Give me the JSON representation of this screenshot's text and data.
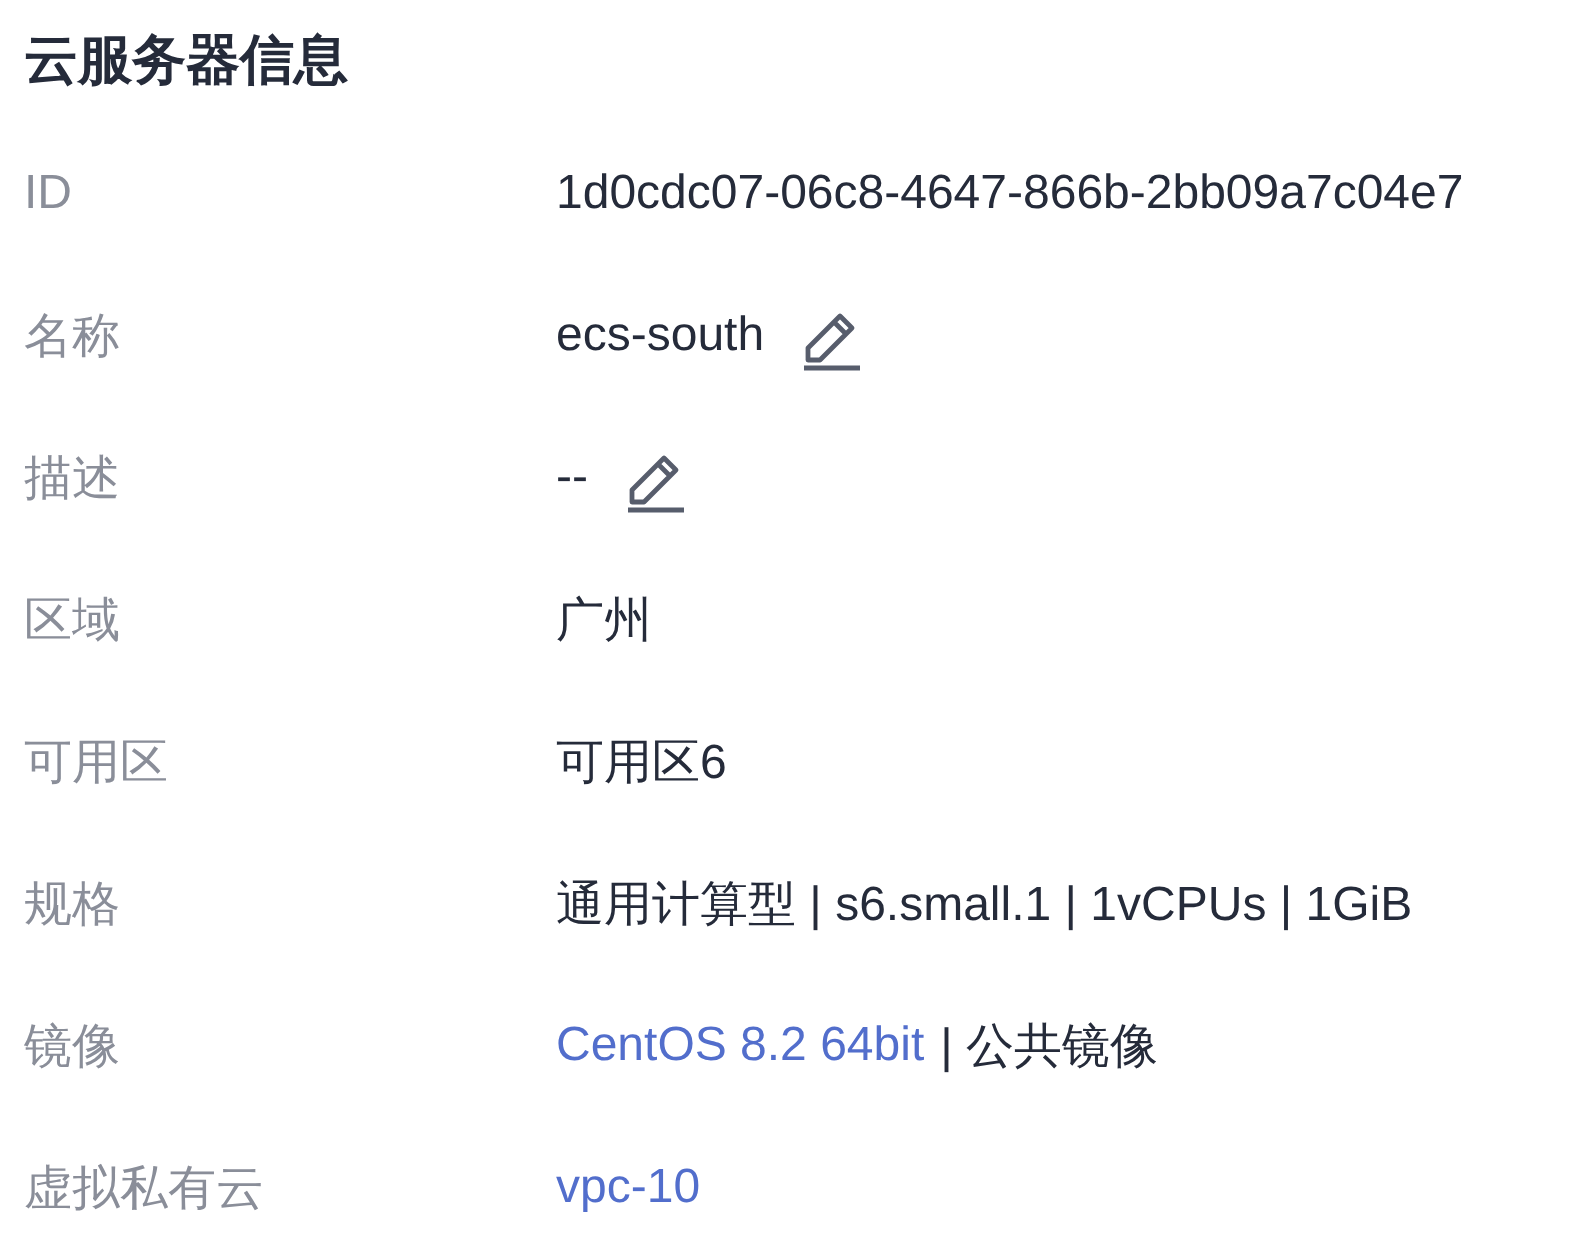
{
  "title": "云服务器信息",
  "rows": [
    {
      "label": "ID",
      "value": [
        {
          "kind": "text",
          "text": "1d0cdc07-06c8-4647-866b-2bb09a7c04e7"
        }
      ],
      "editable": false
    },
    {
      "label": "名称",
      "value": [
        {
          "kind": "text",
          "text": "ecs-south"
        }
      ],
      "editable": true
    },
    {
      "label": "描述",
      "value": [
        {
          "kind": "text",
          "text": "--"
        }
      ],
      "editable": true
    },
    {
      "label": "区域",
      "value": [
        {
          "kind": "text",
          "text": "广州"
        }
      ],
      "editable": false
    },
    {
      "label": "可用区",
      "value": [
        {
          "kind": "text",
          "text": "可用区6"
        }
      ],
      "editable": false
    },
    {
      "label": "规格",
      "value": [
        {
          "kind": "text",
          "text": "通用计算型 | s6.small.1 | 1vCPUs | 1GiB"
        }
      ],
      "editable": false
    },
    {
      "label": "镜像",
      "value": [
        {
          "kind": "link",
          "text": "CentOS 8.2 64bit"
        },
        {
          "kind": "text",
          "text": "| 公共镜像"
        }
      ],
      "editable": false
    },
    {
      "label": "虚拟私有云",
      "value": [
        {
          "kind": "link",
          "text": "vpc-10"
        }
      ],
      "editable": false
    }
  ]
}
